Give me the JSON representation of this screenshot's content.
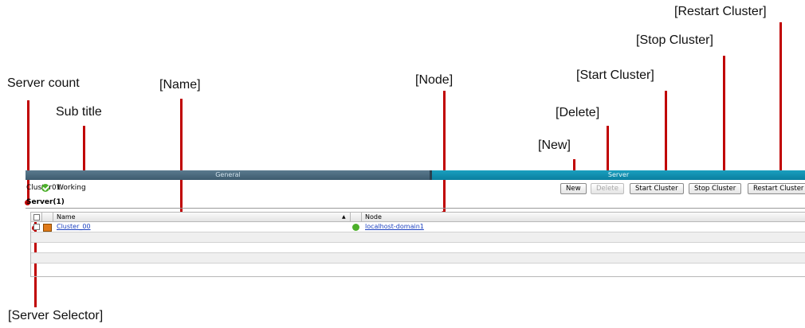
{
  "callouts": {
    "restart_cluster": "[Restart Cluster]",
    "stop_cluster": "[Stop Cluster]",
    "start_cluster": "[Start Cluster]",
    "server_count": "Server count",
    "name": "[Name]",
    "node": "[Node]",
    "sub_title": "Sub title",
    "delete": "[Delete]",
    "new": "[New]",
    "server_selector": "[Server Selector]"
  },
  "tabs": {
    "general": "General",
    "server": "Server"
  },
  "subtitle": {
    "cluster_name": "Cluster01",
    "status": "Working"
  },
  "toolbar": {
    "new": "New",
    "delete": "Delete",
    "start_cluster": "Start Cluster",
    "stop_cluster": "Stop Cluster",
    "restart_cluster": "Restart Cluster"
  },
  "section": {
    "server_count_title": "Server(1)"
  },
  "table": {
    "headers": {
      "name": "Name",
      "sort_indicator": "▲",
      "node": "Node"
    },
    "rows": [
      {
        "name": "Cluster_00",
        "node": "localhost-domain1"
      }
    ]
  },
  "colors": {
    "callout_line": "#c00000",
    "general_tab": "#4a6a7e",
    "server_tab": "#1290b0",
    "status_ok": "#4caf2a",
    "link": "#1a3fbf"
  }
}
